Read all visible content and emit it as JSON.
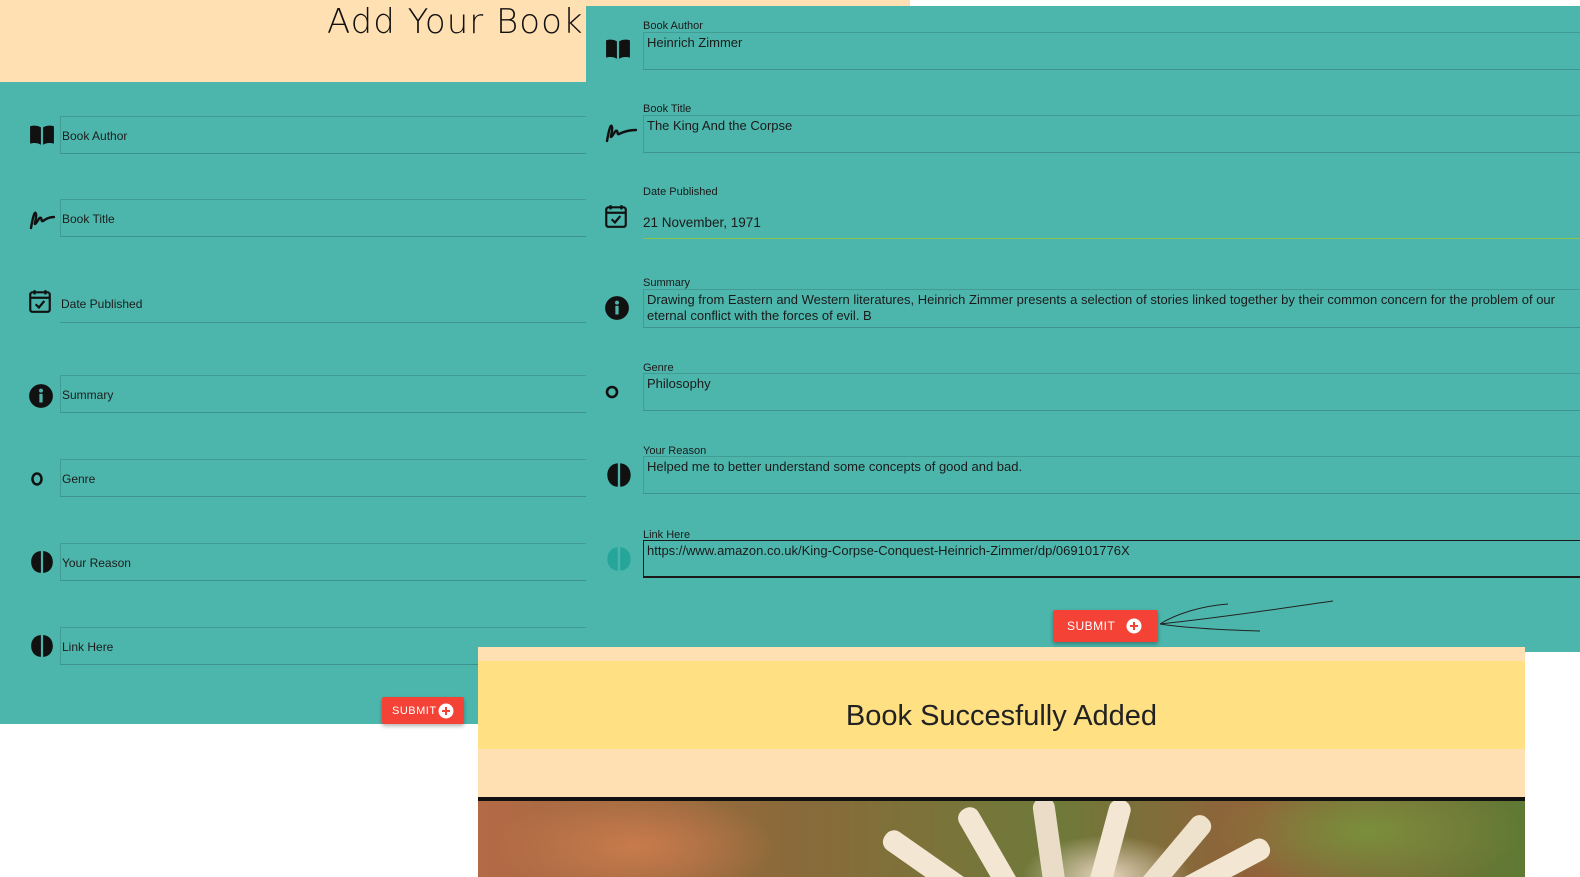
{
  "left_form": {
    "title": "Add Your Book",
    "fields": [
      {
        "label": "Book Author"
      },
      {
        "label": "Book Title"
      },
      {
        "label": "Date Published"
      },
      {
        "label": "Summary"
      },
      {
        "label": "Genre"
      },
      {
        "label": "Your Reason"
      },
      {
        "label": "Link Here"
      }
    ],
    "submit_label": "SUBMIT"
  },
  "right_form": {
    "fields": [
      {
        "label": "Book Author",
        "value": "Heinrich Zimmer"
      },
      {
        "label": "Book Title",
        "value": "The King And the Corpse"
      },
      {
        "label": "Date Published",
        "value": "21 November, 1971"
      },
      {
        "label": "Summary",
        "value": "Drawing from Eastern and Western literatures, Heinrich Zimmer presents a selection of stories linked together by their common concern for the problem of our eternal conflict with the forces of evil. B"
      },
      {
        "label": "Genre",
        "value": "Philosophy"
      },
      {
        "label": "Your Reason",
        "value": "Helped me to better understand some concepts of good and bad."
      },
      {
        "label": "Link Here",
        "value": "https://www.amazon.co.uk/King-Corpse-Conquest-Heinrich-Zimmer/dp/069101776X"
      }
    ],
    "submit_label": "SUBMIT"
  },
  "success": {
    "message": "Book Succesfully Added"
  },
  "icons": [
    "book-open-icon",
    "signature-icon",
    "calendar-check-icon",
    "info-icon",
    "ring-icon",
    "brain-icon",
    "plus-circle-icon"
  ],
  "colors": {
    "teal_panel": "#4db6ac",
    "peach": "#ffe0b2",
    "yellow_banner": "#ffe082",
    "submit_red": "#f44336"
  }
}
